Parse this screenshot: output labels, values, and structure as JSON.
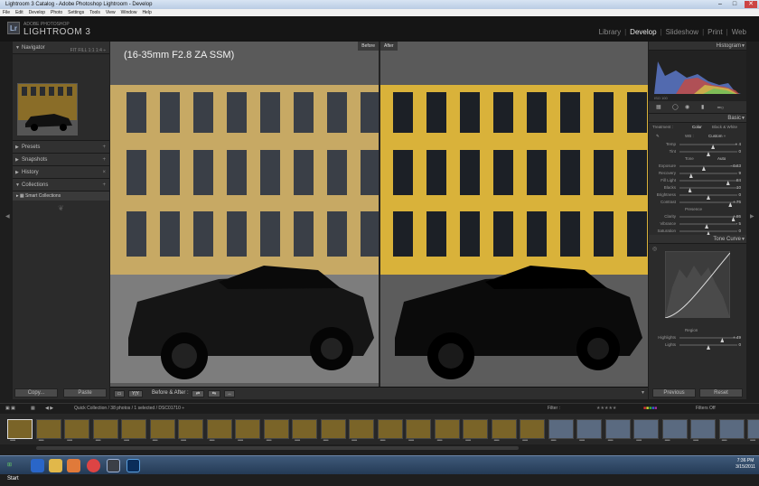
{
  "window": {
    "title": "Lightroom 3 Catalog - Adobe Photoshop Lightroom - Develop"
  },
  "menu": [
    "File",
    "Edit",
    "Develop",
    "Photo",
    "Settings",
    "Tools",
    "View",
    "Window",
    "Help"
  ],
  "identity": {
    "logo": "Lr",
    "brand_small": "ADOBE PHOTOSHOP",
    "brand_big": "LIGHTROOM 3"
  },
  "modules": {
    "library": "Library",
    "develop": "Develop",
    "slideshow": "Slideshow",
    "print": "Print",
    "web": "Web"
  },
  "left": {
    "navigator": "Navigator",
    "zoom": "FIT   FILL   1:1   1:4 ÷",
    "presets": "Presets",
    "snapshots": "Snapshots",
    "history": "History",
    "collections": "Collections",
    "smart_collections": "Smart Collections"
  },
  "center": {
    "before": "Before",
    "after": "After",
    "lens": "(16-35mm F2.8 ZA SSM)",
    "toolbar_label": "Before & After :",
    "yy": "Y|Y"
  },
  "buttons": {
    "copy": "Copy...",
    "paste": "Paste",
    "previous": "Previous",
    "reset": "Reset"
  },
  "right": {
    "histogram": "Histogram",
    "basic": "Basic",
    "tone_curve": "Tone Curve",
    "treatment": "Treatment :",
    "color": "Color",
    "bw": "Black & White",
    "wb": "WB :",
    "wb_value": "Custom ÷",
    "tone": "Tone",
    "auto": "Auto",
    "presence": "Presence",
    "region": "Region",
    "hist_caption": "ISO 100",
    "temp": {
      "name": "Temp",
      "value": "+ 4"
    },
    "tint": {
      "name": "Tint",
      "value": "0"
    },
    "exposure": {
      "name": "Exposure",
      "value": "- 0.63"
    },
    "recovery": {
      "name": "Recovery",
      "value": "9"
    },
    "fill": {
      "name": "Fill Light",
      "value": "84"
    },
    "blacks": {
      "name": "Blacks",
      "value": "10"
    },
    "brightness": {
      "name": "Brightness",
      "value": "0"
    },
    "contrast": {
      "name": "Contrast",
      "value": "+ 76"
    },
    "clarity": {
      "name": "Clarity",
      "value": "+ 86"
    },
    "vibrance": {
      "name": "Vibrance",
      "value": "- 5"
    },
    "saturation": {
      "name": "Saturation",
      "value": "0"
    },
    "highlights": {
      "name": "Highlights",
      "value": "+ 49"
    },
    "lights": {
      "name": "Lights",
      "value": "0"
    }
  },
  "filmstrip": {
    "info": "Quick Collection / 38 photos / 1 selected / DSC01710 ÷",
    "filter": "Filter :",
    "filters_off": "Filters Off"
  },
  "taskbar": {
    "start": "Start",
    "time": "7:36 PM",
    "date": "3/15/2011"
  }
}
